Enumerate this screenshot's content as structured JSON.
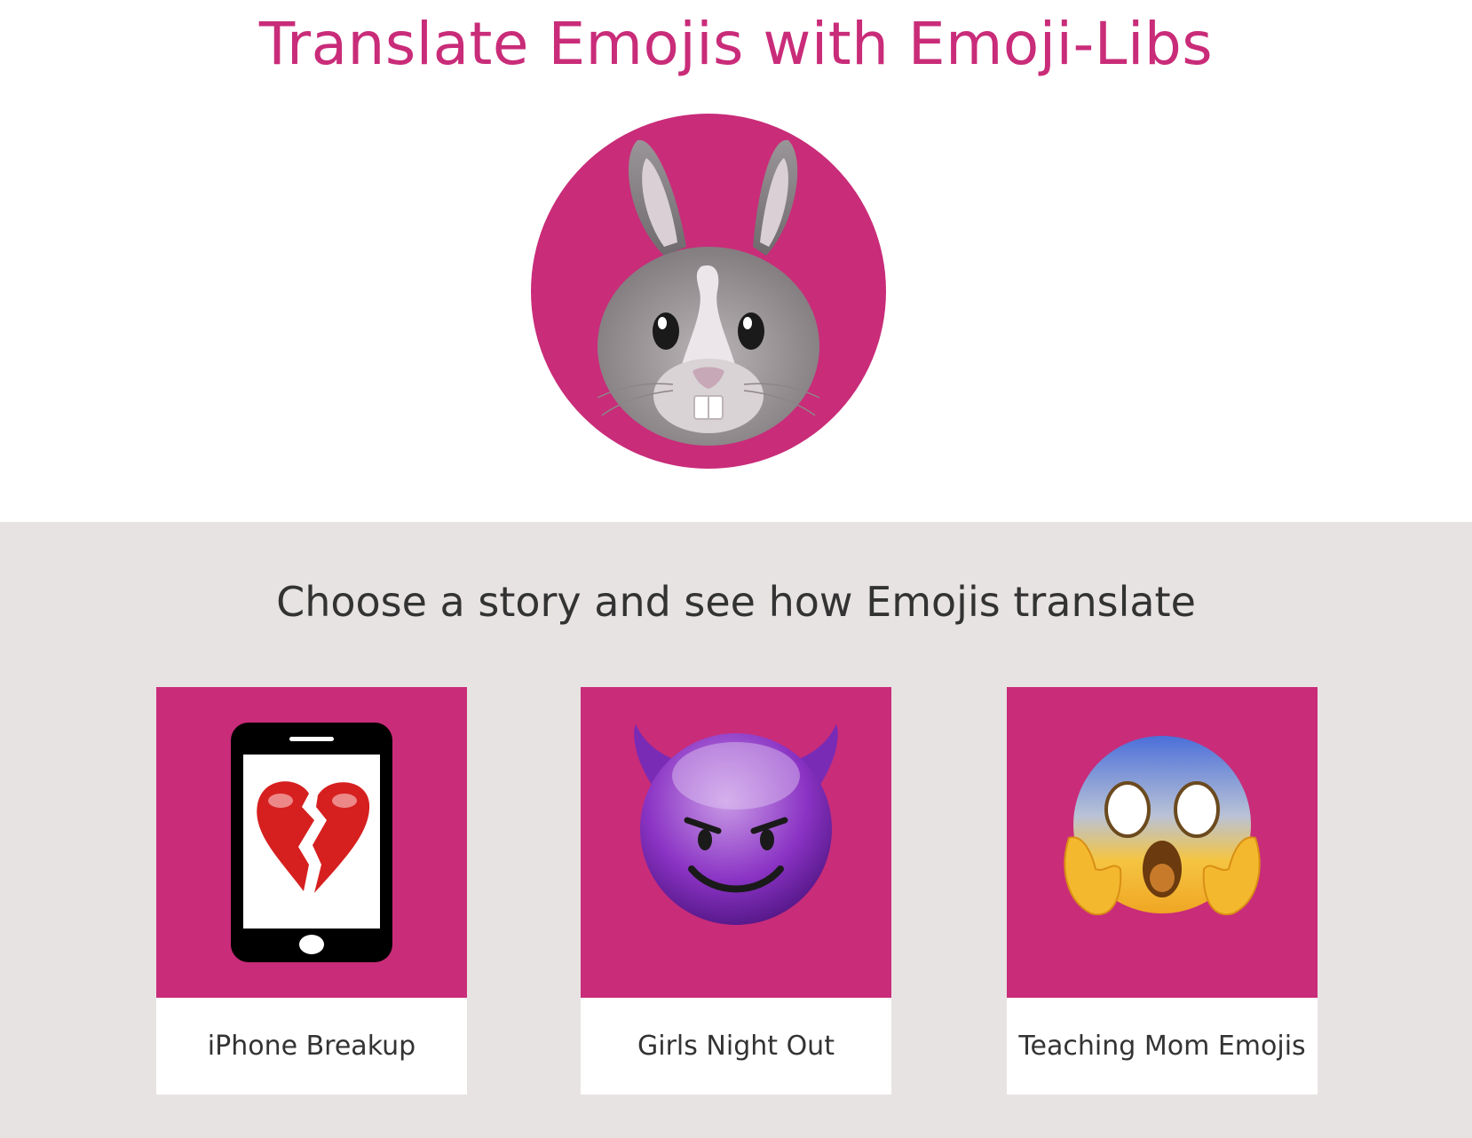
{
  "header": {
    "title": "Translate Emojis with Emoji-Libs",
    "logo_icon": "rabbit-face-icon"
  },
  "stories": {
    "heading": "Choose a story and see how Emojis translate",
    "items": [
      {
        "label": "iPhone Breakup",
        "icon": "phone-broken-heart-icon"
      },
      {
        "label": "Girls Night Out",
        "icon": "smiling-devil-icon"
      },
      {
        "label": "Teaching Mom Emojis",
        "icon": "screaming-face-icon"
      }
    ]
  },
  "colors": {
    "accent": "#c92c79",
    "section_background": "#e8e3e3",
    "text": "#333333"
  }
}
